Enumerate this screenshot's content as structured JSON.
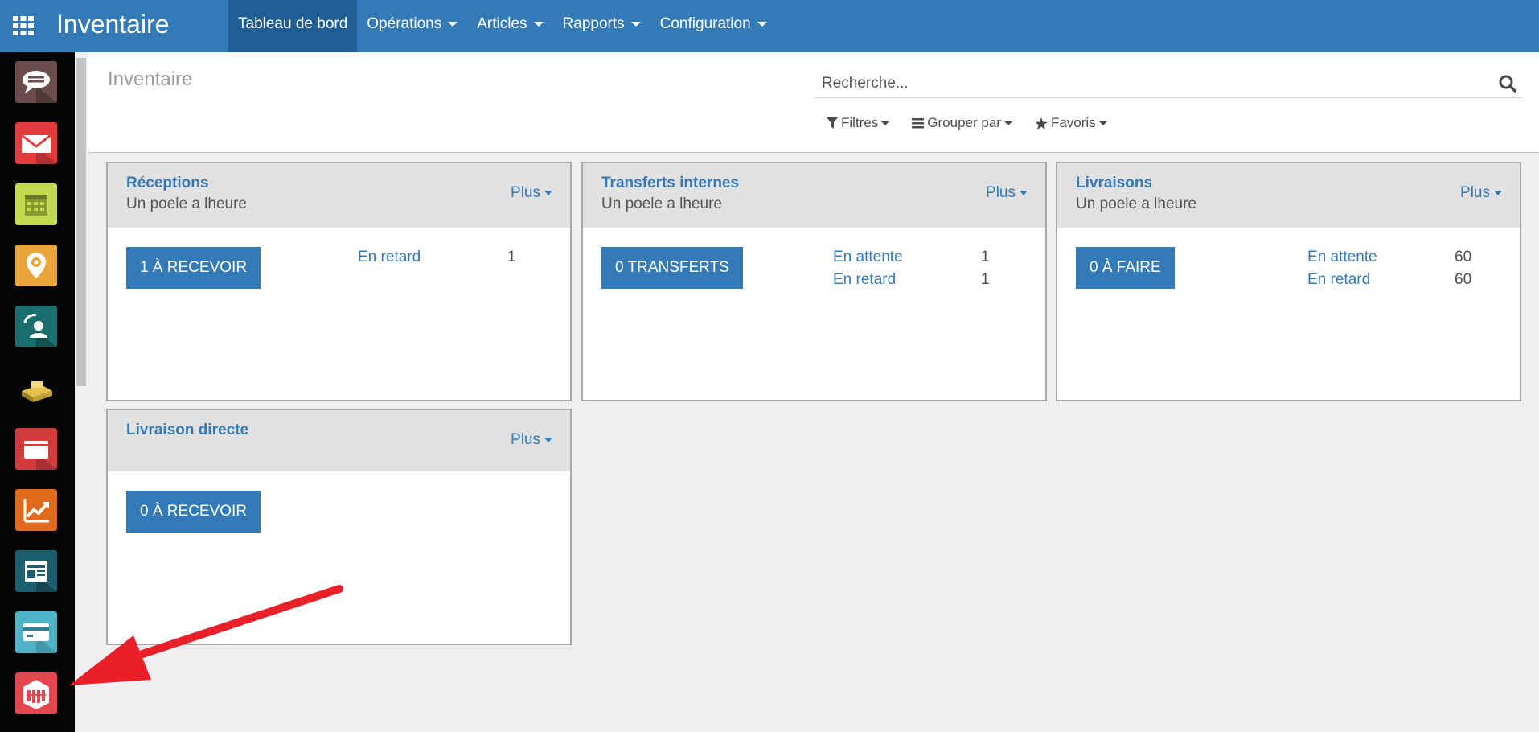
{
  "navbar": {
    "app_title": "Inventaire",
    "menu": [
      {
        "label": "Tableau de bord",
        "active": true,
        "dropdown": false
      },
      {
        "label": "Opérations",
        "active": false,
        "dropdown": true
      },
      {
        "label": "Articles",
        "active": false,
        "dropdown": true
      },
      {
        "label": "Rapports",
        "active": false,
        "dropdown": true
      },
      {
        "label": "Configuration",
        "active": false,
        "dropdown": true
      }
    ]
  },
  "sidebar": {
    "apps": [
      {
        "icon": "discuss-icon",
        "color": "#6d4c4c"
      },
      {
        "icon": "mail-icon",
        "color": "#e23b3b"
      },
      {
        "icon": "calendar-icon",
        "color": "#c5d94e"
      },
      {
        "icon": "crm-icon",
        "color": "#e9a53a"
      },
      {
        "icon": "contacts-icon",
        "color": "#1b6e6e"
      },
      {
        "icon": "sales-icon",
        "color": "#050505"
      },
      {
        "icon": "documents-icon",
        "color": "#d33c3c"
      },
      {
        "icon": "reporting-icon",
        "color": "#e26a1d"
      },
      {
        "icon": "website-icon",
        "color": "#1b5f6f"
      },
      {
        "icon": "invoicing-icon",
        "color": "#4fb3c7"
      },
      {
        "icon": "inventory-icon",
        "color": "#e4464f"
      }
    ]
  },
  "control_panel": {
    "breadcrumb": "Inventaire",
    "search_placeholder": "Recherche...",
    "filters_label": "Filtres",
    "group_by_label": "Grouper par",
    "favorites_label": "Favoris"
  },
  "cards": [
    {
      "title": "Réceptions",
      "subtitle": "Un poele a lheure",
      "more_label": "Plus",
      "button_label": "1 À RECEVOIR",
      "stats": [
        {
          "label": "En retard",
          "value": "1"
        }
      ]
    },
    {
      "title": "Transferts internes",
      "subtitle": "Un poele a lheure",
      "more_label": "Plus",
      "button_label": "0 TRANSFERTS",
      "stats": [
        {
          "label": "En attente",
          "value": "1"
        },
        {
          "label": "En retard",
          "value": "1"
        }
      ]
    },
    {
      "title": "Livraisons",
      "subtitle": "Un poele a lheure",
      "more_label": "Plus",
      "button_label": "0 À FAIRE",
      "stats": [
        {
          "label": "En attente",
          "value": "60"
        },
        {
          "label": "En retard",
          "value": "60"
        }
      ]
    },
    {
      "title": "Livraison directe",
      "subtitle": "",
      "more_label": "Plus",
      "button_label": "0 À RECEVOIR",
      "stats": []
    }
  ],
  "colors": {
    "primary": "#337ab7",
    "annotation_arrow": "#e8202a"
  }
}
